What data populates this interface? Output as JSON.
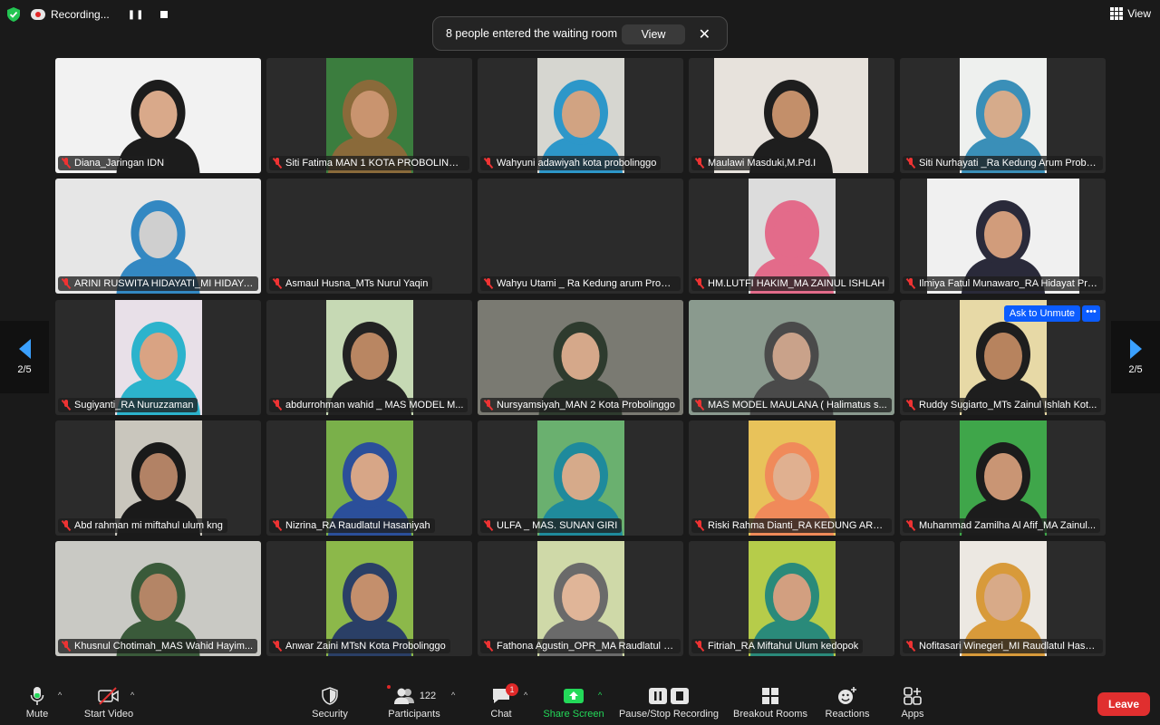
{
  "topbar": {
    "recording_label": "Recording...",
    "pause_glyph": "❚❚",
    "view_label": "View"
  },
  "notification": {
    "message": "8 people entered the waiting room",
    "view_button": "View",
    "close_glyph": "✕"
  },
  "pager": {
    "left": "2/5",
    "right": "2/5"
  },
  "tile_controls": {
    "ask_unmute": "Ask to Unmute",
    "more": "•••"
  },
  "participants": [
    {
      "name": "Diana_Jaringan IDN",
      "bg": "#f2f2f2",
      "skin": "#d9a98a",
      "hijab": "#1c1c1c"
    },
    {
      "name": "Siti Fatima MAN 1 KOTA PROBOLINGGO",
      "bg": "#3b7d3e",
      "skin": "#c9946f",
      "hijab": "#8a6a3a"
    },
    {
      "name": "Wahyuni adawiyah kota probolinggo",
      "bg": "#d6d6d0",
      "skin": "#d1a382",
      "hijab": "#2d97c9"
    },
    {
      "name": "Maulawi Masduki,M.Pd.I",
      "bg": "#e7e2dc",
      "skin": "#c38f6a",
      "hijab": "#1e1e1e"
    },
    {
      "name": "Siti Nurhayati _Ra Kedung Arum Probo...",
      "bg": "#eef0ee",
      "skin": "#d6ab8b",
      "hijab": "#3a8fb8"
    },
    {
      "name": "ARINI RUSWITA HIDAYATI_MI HIDAYAT...",
      "bg": "#e6e6e6",
      "skin": "#cfcfcf",
      "hijab": "#3388c2"
    },
    {
      "name": "Asmaul Husna_MTs Nurul Yaqin",
      "bg": "",
      "skin": "",
      "hijab": ""
    },
    {
      "name": "Wahyu Utami _ Ra Kedung arum Probo...",
      "bg": "",
      "skin": "",
      "hijab": ""
    },
    {
      "name": "HM.LUTFI HAKIM_MA ZAINUL ISHLAH",
      "bg": "#dcdcdc",
      "skin": "#e36b8a",
      "hijab": "#e36b8a"
    },
    {
      "name": "Ilmiya Fatul Munawaro_RA Hidayat Pro...",
      "bg": "#f0f0f0",
      "skin": "#d19c7b",
      "hijab": "#2a2a3a"
    },
    {
      "name": "Sugiyanti_RA Nuruzzaman",
      "bg": "#e8e0e8",
      "skin": "#d9a383",
      "hijab": "#2cb3cc"
    },
    {
      "name": "abdurrohman wahid _ MAS MODEL M...",
      "bg": "#c6d9b4",
      "skin": "#b98662",
      "hijab": "#222222"
    },
    {
      "name": "Nursyamsiyah_MAN 2 Kota Probolinggo",
      "bg": "#7a7a72",
      "skin": "#d5a88a",
      "hijab": "#2e3b2e"
    },
    {
      "name": "MAS MODEL MAULANA ( Halimatus s...",
      "bg": "#8a9a8e",
      "skin": "#c9a28a",
      "hijab": "#4a4a4a"
    },
    {
      "name": "Ruddy Sugiarto_MTs Zainul Ishlah Kot...",
      "bg": "#e7d9a6",
      "skin": "#b7835e",
      "hijab": "#1e1e1e"
    },
    {
      "name": "Abd rahman mi miftahul ulum kng",
      "bg": "#c9c6bd",
      "skin": "#b28265",
      "hijab": "#1a1a1a"
    },
    {
      "name": "Nizrina_RA Raudlatul Hasaniyah",
      "bg": "#7ab04a",
      "skin": "#d7a687",
      "hijab": "#2b4f9a"
    },
    {
      "name": "ULFA _ MAS. SUNAN GIRI",
      "bg": "#6ab06f",
      "skin": "#d6aa8a",
      "hijab": "#1f8a9c"
    },
    {
      "name": "Riski Rahma Dianti_RA KEDUNG ARU...",
      "bg": "#e8c25a",
      "skin": "#e0b090",
      "hijab": "#f08a5a"
    },
    {
      "name": "Muhammad Zamilha Al Afif_MA Zainul...",
      "bg": "#3fa64a",
      "skin": "#c99574",
      "hijab": "#1c1c1c"
    },
    {
      "name": "Khusnul Chotimah_MAS Wahid Hayim...",
      "bg": "#c9c9c4",
      "skin": "#b48566",
      "hijab": "#3a5a3a"
    },
    {
      "name": "Anwar Zaini MTsN Kota Probolinggo",
      "bg": "#8cb84a",
      "skin": "#c48f6c",
      "hijab": "#2a3f66"
    },
    {
      "name": "Fathona Agustin_OPR_MA Raudlatul H...",
      "bg": "#cfd9a8",
      "skin": "#e0b598",
      "hijab": "#6a6a6a"
    },
    {
      "name": "Fitriah_RA Miftahul Ulum kedopok",
      "bg": "#b6cc4a",
      "skin": "#d29f80",
      "hijab": "#2a8a7a"
    },
    {
      "name": "Nofitasari Winegeri_MI Raudlatul Hasa...",
      "bg": "#ece8e2",
      "skin": "#d8aa88",
      "hijab": "#d89a3a"
    }
  ],
  "toolbar": {
    "mute": "Mute",
    "start_video": "Start Video",
    "security": "Security",
    "participants": "Participants",
    "participants_count": "122",
    "chat": "Chat",
    "chat_badge": "1",
    "share_screen": "Share Screen",
    "pause_recording": "Pause/Stop Recording",
    "breakout_rooms": "Breakout Rooms",
    "reactions": "Reactions",
    "apps": "Apps",
    "leave": "Leave",
    "caret_glyph": "^"
  },
  "colors": {
    "accent_blue": "#0b5cff",
    "share_green": "#23d959",
    "leave_red": "#e02f2f",
    "muted_red": "#e33333"
  }
}
